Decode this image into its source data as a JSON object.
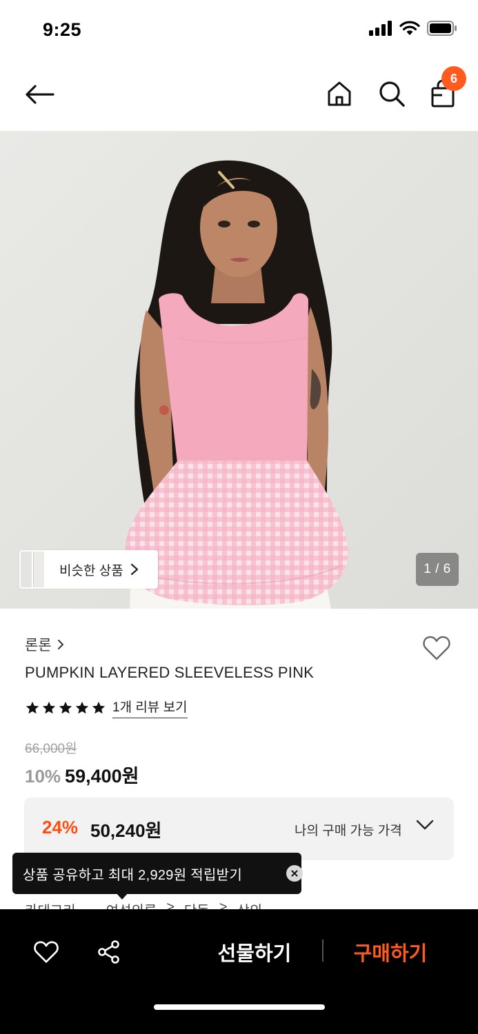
{
  "status_bar": {
    "time": "9:25",
    "icons": [
      "cellular-signal-icon",
      "wifi-icon",
      "battery-icon"
    ]
  },
  "header": {
    "back_icon": "arrow-left-icon",
    "home_icon": "home-icon",
    "search_icon": "search-icon",
    "cart_icon": "shopping-bag-icon",
    "cart_count": "6"
  },
  "gallery": {
    "similar_label": "비슷한 상품",
    "page_counter": "1 / 6"
  },
  "product": {
    "brand": "론론",
    "title": "PUMPKIN LAYERED SLEEVELESS PINK",
    "rating": 5,
    "review_link": "1개 리뷰 보기",
    "original_price": "66,000원",
    "discount_rate": "10%",
    "sale_price": "59,400원"
  },
  "my_price": {
    "discount_rate": "24%",
    "price": "50,240원",
    "label": "나의 구매 가능 가격"
  },
  "category": {
    "label": "카테고리",
    "path": [
      "여성의류",
      "단독",
      "상의"
    ]
  },
  "tooltip": {
    "text": "상품 공유하고 최대 2,929원 적립받기"
  },
  "bottom_bar": {
    "gift_label": "선물하기",
    "buy_label": "구매하기"
  },
  "colors": {
    "accent": "#ff5a1f",
    "discount": "#ff4d12",
    "top_pink": "#f4a9bd"
  }
}
